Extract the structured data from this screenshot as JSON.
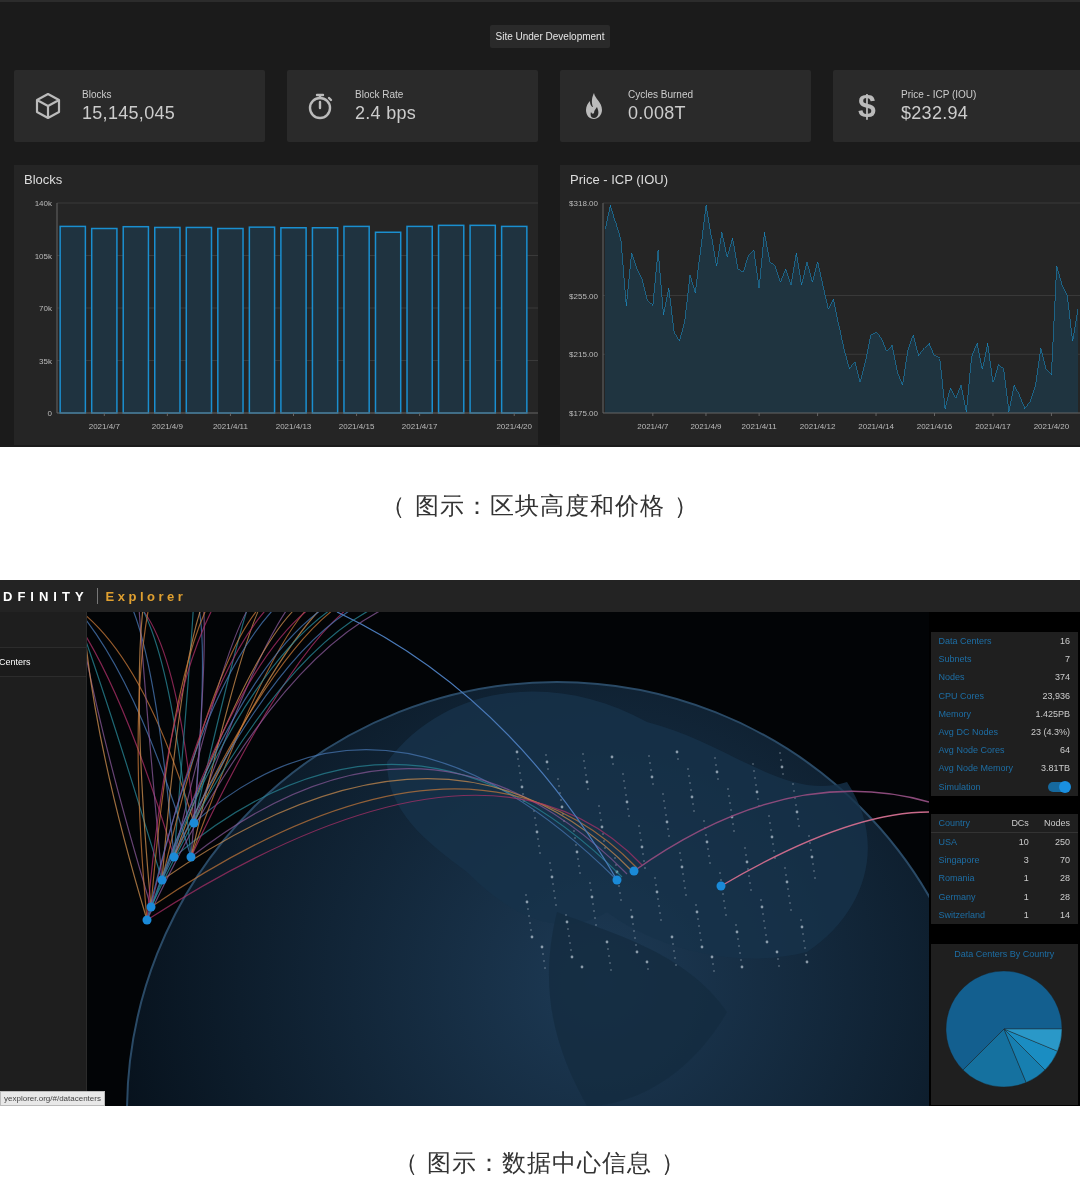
{
  "dashboard": {
    "notice": "Site Under Development",
    "stats": [
      {
        "label": "Blocks",
        "value": "15,145,045"
      },
      {
        "label": "Block Rate",
        "value": "2.4 bps"
      },
      {
        "label": "Cycles Burned",
        "value": "0.008T"
      },
      {
        "glyph": "$",
        "label": "Price - ICP (IOU)",
        "value": "$232.94"
      }
    ],
    "blocks_chart": {
      "title": "Blocks",
      "chart_data": {
        "type": "bar",
        "categories": [
          null,
          "2021/4/7",
          null,
          "2021/4/9",
          null,
          "2021/4/11",
          null,
          "2021/4/13",
          null,
          "2021/4/15",
          null,
          "2021/4/17",
          null,
          null,
          "2021/4/20"
        ],
        "grid": true,
        "values": [
          124400,
          123000,
          124200,
          123700,
          123700,
          123000,
          123900,
          123500,
          123500,
          124400,
          120500,
          124400,
          125100,
          125100,
          124400
        ],
        "ylim": [
          0,
          140000
        ],
        "yticks": [
          {
            "value": 0,
            "label": "0"
          },
          {
            "value": 35000,
            "label": "35k"
          },
          {
            "value": 70000,
            "label": "70k"
          },
          {
            "value": 105000,
            "label": "105k"
          },
          {
            "value": 140000,
            "label": "140k"
          }
        ]
      }
    },
    "price_chart": {
      "title": "Price - ICP (IOU)",
      "chart_data": {
        "type": "area",
        "categories": [
          null,
          null,
          null,
          null,
          null,
          null,
          null,
          null,
          null,
          "2021/4/7",
          null,
          null,
          null,
          null,
          null,
          null,
          null,
          null,
          null,
          "2021/4/9",
          null,
          null,
          null,
          null,
          null,
          null,
          null,
          null,
          null,
          "2021/4/11",
          null,
          null,
          null,
          null,
          null,
          null,
          null,
          null,
          null,
          null,
          "2021/4/12",
          null,
          null,
          null,
          null,
          null,
          null,
          null,
          null,
          null,
          null,
          "2021/4/14",
          null,
          null,
          null,
          null,
          null,
          null,
          null,
          null,
          null,
          null,
          "2021/4/16",
          null,
          null,
          null,
          null,
          null,
          null,
          null,
          null,
          null,
          null,
          "2021/4/17",
          null,
          null,
          null,
          null,
          null,
          null,
          null,
          null,
          null,
          null,
          "2021/4/20",
          null,
          null,
          null,
          null,
          null
        ],
        "grid": true,
        "values": [
          300,
          317,
          305,
          293,
          248,
          284,
          273,
          266,
          251,
          248,
          286,
          242,
          260,
          230,
          224,
          237,
          269,
          257,
          287,
          317,
          296,
          275,
          298,
          281,
          294,
          273,
          271,
          282,
          286,
          260,
          298,
          278,
          275,
          264,
          273,
          262,
          284,
          262,
          278,
          264,
          278,
          262,
          246,
          253,
          235,
          218,
          205,
          210,
          196,
          210,
          228,
          230,
          226,
          217,
          221,
          203,
          194,
          218,
          228,
          214,
          219,
          223,
          214,
          212,
          178,
          192,
          185,
          194,
          176,
          214,
          223,
          205,
          223,
          196,
          208,
          205,
          176,
          194,
          187,
          178,
          183,
          194,
          219,
          205,
          201,
          275,
          262,
          255,
          224,
          246
        ],
        "ylim": [
          175,
          318
        ],
        "yticks": [
          {
            "value": 175,
            "label": "$175.00"
          },
          {
            "value": 215,
            "label": "$215.00"
          },
          {
            "value": 255,
            "label": "$255.00"
          },
          {
            "value": 318,
            "label": "$318.00"
          }
        ]
      }
    }
  },
  "caption_1": "（ 图示：区块高度和价格 ）",
  "explorer": {
    "logo": {
      "brand": "DFINITY",
      "product": "Explorer"
    },
    "sidebar": {
      "items": [
        {
          "label": "Centers",
          "selected": true
        }
      ]
    },
    "stats": [
      {
        "kind": "value",
        "label": "Data Centers",
        "value": "16"
      },
      {
        "kind": "value",
        "label": "Subnets",
        "value": "7"
      },
      {
        "kind": "value",
        "label": "Nodes",
        "value": "374"
      },
      {
        "kind": "value",
        "label": "CPU Cores",
        "value": "23,936"
      },
      {
        "kind": "value",
        "label": "Memory",
        "value": "1.425PB"
      },
      {
        "kind": "value",
        "label": "Avg DC Nodes",
        "value": "23 (4.3%)"
      },
      {
        "kind": "value",
        "label": "Avg Node Cores",
        "value": "64"
      },
      {
        "kind": "value",
        "label": "Avg Node Memory",
        "value": "3.81TB"
      },
      {
        "kind": "toggle",
        "label": "Simulation",
        "on": true
      }
    ],
    "countries": {
      "columns": [
        "Country",
        "DCs",
        "Nodes"
      ],
      "rows": [
        [
          "USA",
          "10",
          "250"
        ],
        [
          "Singapore",
          "3",
          "70"
        ],
        [
          "Romania",
          "1",
          "28"
        ],
        [
          "Germany",
          "1",
          "28"
        ],
        [
          "Switzerland",
          "1",
          "14"
        ]
      ]
    },
    "pie": {
      "title": "Data Centers By Country"
    },
    "status_url": "yexplorer.org/#/datacenters"
  },
  "caption_2": "（ 图示：数据中心信息 ）"
}
